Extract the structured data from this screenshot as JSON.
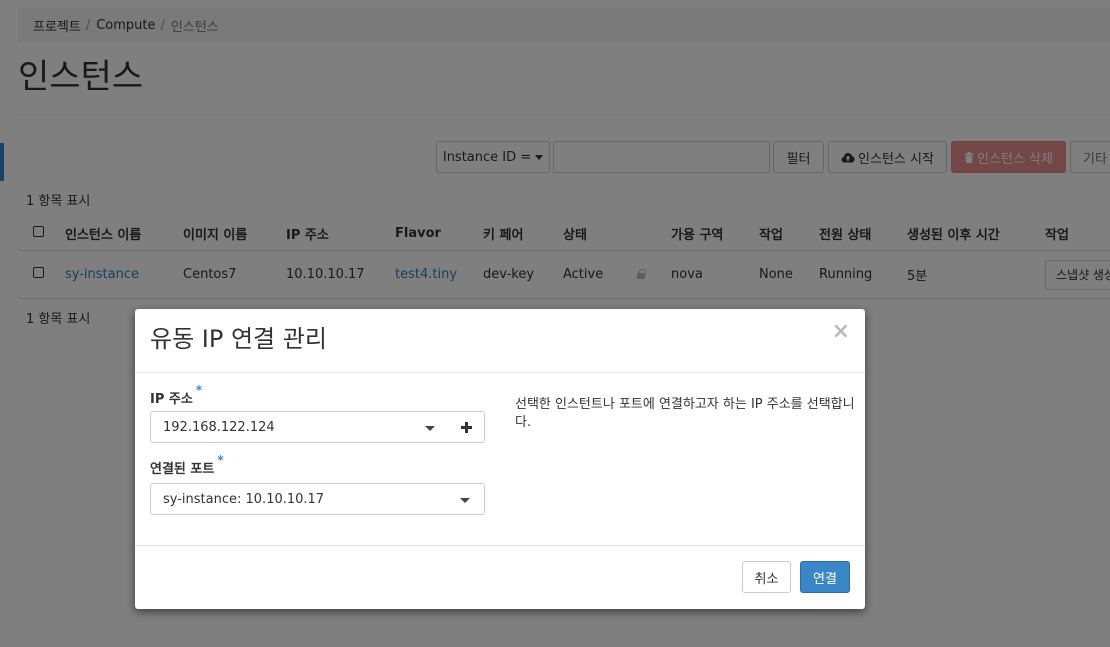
{
  "breadcrumb": {
    "items": [
      "프로젝트",
      "Compute",
      "인스턴스"
    ],
    "separator": "/"
  },
  "page": {
    "title": "인스턴스"
  },
  "toolbar": {
    "filter_field": "Instance ID =",
    "filter_value": "",
    "filter_button": "필터",
    "launch_button": "인스턴스 시작",
    "delete_button": "인스턴스 삭제",
    "more_button": "기타"
  },
  "table": {
    "count_top": "1 항목 표시",
    "count_bottom": "1 항목 표시",
    "columns": [
      "인스턴스 이름",
      "이미지 이름",
      "IP 주소",
      "Flavor",
      "키 페어",
      "상태",
      "가용 구역",
      "작업",
      "전원 상태",
      "생성된 이후 시간",
      "작업"
    ],
    "rows": [
      {
        "name": "sy-instance",
        "image": "Centos7",
        "ip": "10.10.10.17",
        "flavor": "test4.tiny",
        "keypair": "dev-key",
        "status": "Active",
        "zone": "nova",
        "task": "None",
        "power": "Running",
        "age": "5분",
        "action_button": "스냅샷 생성"
      }
    ]
  },
  "modal": {
    "title": "유동 IP 연결 관리",
    "close": "×",
    "ip_label": "IP 주소",
    "ip_value": "192.168.122.124",
    "add_icon": "plus-icon",
    "port_label": "연결된 포트",
    "port_value": "sy-instance: 10.10.10.17",
    "required_mark": "*",
    "help_text": "선택한 인스턴트나 포트에 연결하고자 하는 IP 주소를 선택합니다.",
    "cancel_button": "취소",
    "submit_button": "연결"
  },
  "colors": {
    "primary": "#3a87c8",
    "danger": "#d9534f",
    "link": "#337ab7"
  }
}
